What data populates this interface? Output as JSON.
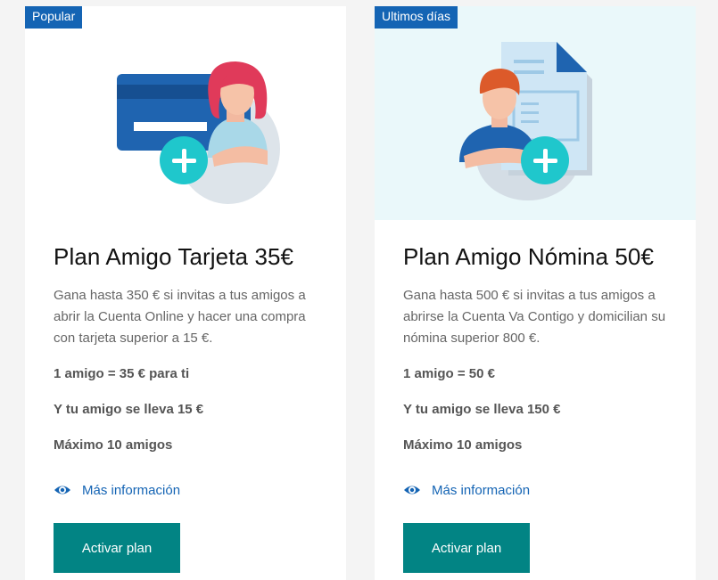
{
  "plans": [
    {
      "badge": "Popular",
      "title": "Plan Amigo Tarjeta 35€",
      "description": "Gana hasta 350 € si invitas a tus amigos a abrir la Cuenta Online y hacer una compra con tarjeta superior a 15 €.",
      "fact_reward": "1 amigo = 35 € para ti",
      "fact_friend": "Y tu amigo se lleva 15 €",
      "fact_max": "Máximo 10 amigos",
      "more_info": "Más información",
      "cta": "Activar plan",
      "illustration": "woman-with-credit-card"
    },
    {
      "badge": "Ultimos días",
      "title": "Plan Amigo Nómina 50€",
      "description": "Gana hasta 500 € si invitas a tus amigos a abrirse la Cuenta Va Contigo y domicilian su nómina superior 800 €.",
      "fact_reward": "1 amigo = 50 €",
      "fact_friend": "Y tu amigo se lleva 150 €",
      "fact_max": "Máximo 10 amigos",
      "more_info": "Más información",
      "cta": "Activar plan",
      "illustration": "man-with-document"
    }
  ],
  "colors": {
    "badge": "#1464b4",
    "button": "#028484",
    "link": "#1464b4",
    "plus_circle": "#1fc7cc"
  },
  "icons": {
    "more_info": "eye-icon",
    "add": "plus-icon"
  }
}
